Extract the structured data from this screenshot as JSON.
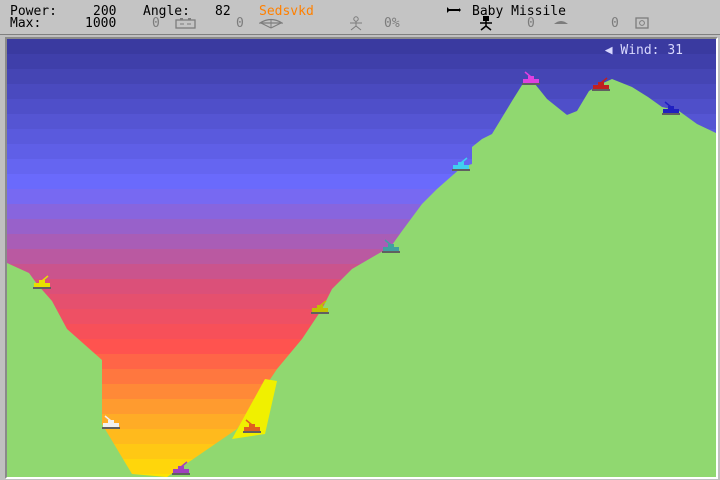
{
  "hud": {
    "power_label": "Power:",
    "power_value": "200",
    "angle_label": "Angle:",
    "angle_value": "82",
    "player_name": "Sedsvkd",
    "weapon_name": "Baby Missile",
    "max_label": "Max:",
    "max_value": "1000",
    "battery_count": "0",
    "parachute_count": "0",
    "fuel_percent": "0%",
    "shield_count": "0",
    "tracer_count": "0",
    "selector_count": "0"
  },
  "wind": {
    "label": "Wind: 31",
    "direction": "left"
  },
  "colors": {
    "ground": "#90d870",
    "sky_top": "#3a3aa0",
    "sky_mid": "#6c6cff",
    "sky_bottom": "#ffe000",
    "hud_bg": "#c4c4c4"
  },
  "tanks": [
    {
      "name": "tank-yellow",
      "color": "#e8e000"
    },
    {
      "name": "tank-white",
      "color": "#f0f0f0"
    },
    {
      "name": "tank-purple",
      "color": "#a040c0"
    },
    {
      "name": "tank-orange",
      "color": "#e06020"
    },
    {
      "name": "tank-olive",
      "color": "#c0c000"
    },
    {
      "name": "tank-teal",
      "color": "#40a0a0"
    },
    {
      "name": "tank-cyan",
      "color": "#40d0f0"
    },
    {
      "name": "tank-magenta",
      "color": "#e040e0"
    },
    {
      "name": "tank-red",
      "color": "#c02020"
    },
    {
      "name": "tank-blue",
      "color": "#2020c0"
    }
  ]
}
